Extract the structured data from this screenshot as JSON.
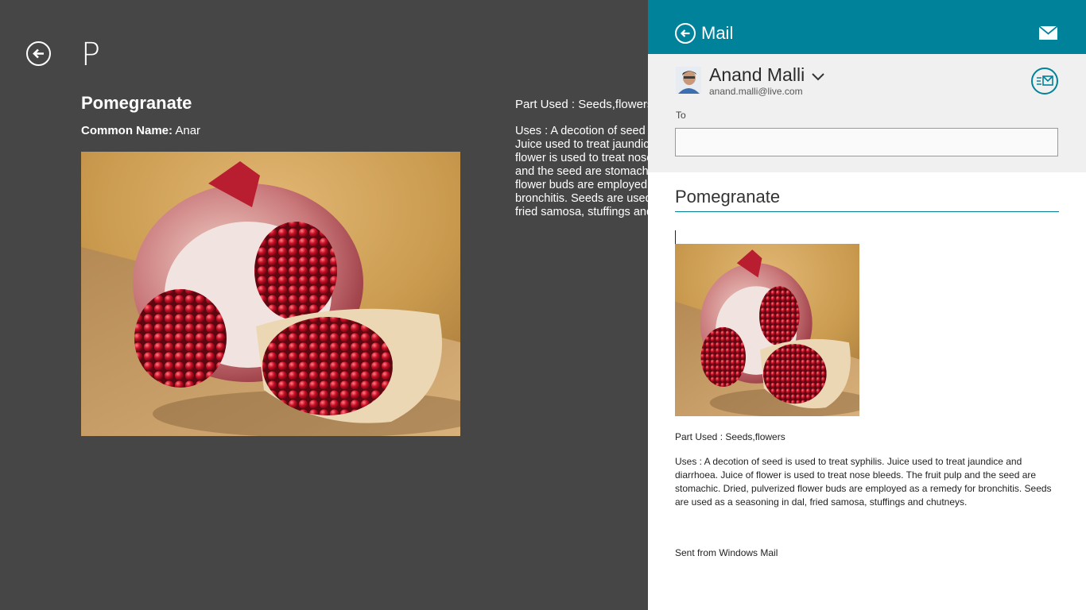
{
  "app": {
    "page_letter": "P",
    "plant": {
      "name": "Pomegranate",
      "common_name_label": "Common Name:",
      "common_name_value": "Anar",
      "part_used_text": "Part Used : Seeds,flowers",
      "uses_text": "Uses : A decotion of seed is used to treat syphilis. Juice used to treat jaundice and diarrhoea. Juice of flower is used to treat nose bleeds. The fruit pulp and the seed are stomachic. Dried, pulverized flower buds are employed as a remedy for bronchitis. Seeds are used as a seasoning in dal, fried samosa, stuffings and chutneys."
    }
  },
  "mail": {
    "title": "Mail",
    "sender_name": "Anand Malli",
    "sender_email": "anand.malli@live.com",
    "to_label": "To",
    "to_value": "",
    "subject": "Pomegranate",
    "body_part_used": "Part Used : Seeds,flowers",
    "body_uses": "Uses : A decotion of seed is used to treat syphilis. Juice used to treat jaundice and diarrhoea. Juice of flower is used to treat nose bleeds. The fruit pulp and the seed are stomachic. Dried, pulverized flower buds are employed as a remedy for bronchitis. Seeds are used as a seasoning in dal, fried samosa, stuffings and chutneys.",
    "signature": "Sent from Windows Mail"
  },
  "icons": {
    "app_back": "back-arrow-icon",
    "mail_back": "back-arrow-icon",
    "envelope": "envelope-icon",
    "chevron": "chevron-down-icon",
    "send": "send-mail-icon"
  },
  "colors": {
    "app_background": "#464646",
    "mail_accent": "#00829b",
    "mail_header_text": "#ffffff",
    "from_area_background": "#f0f0f0"
  }
}
